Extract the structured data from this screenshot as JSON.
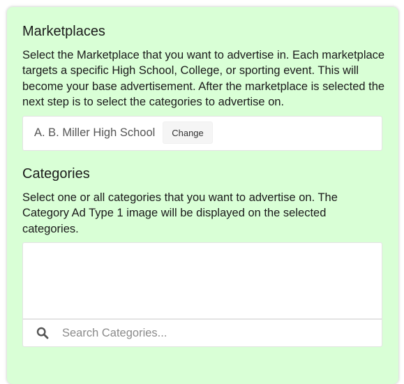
{
  "marketplaces": {
    "title": "Marketplaces",
    "description": "Select the Marketplace that you want to advertise in. Each marketplace targets a specific High School, College, or sporting event. This will become your base advertisement. After the marketplace is selected the next step is to select the categories to advertise on.",
    "selected_name": "A. B. Miller High School",
    "change_label": "Change"
  },
  "categories": {
    "title": "Categories",
    "description": "Select one or all categories that you want to advertise on. The Category Ad Type 1 image will be displayed on the selected categories.",
    "items": [],
    "search_placeholder": "Search Categories...",
    "search_value": ""
  },
  "icons": {
    "search": "search-icon"
  },
  "colors": {
    "card_background": "#d9ffd6",
    "text": "#1a1a1a",
    "placeholder": "#8a8a8a"
  }
}
